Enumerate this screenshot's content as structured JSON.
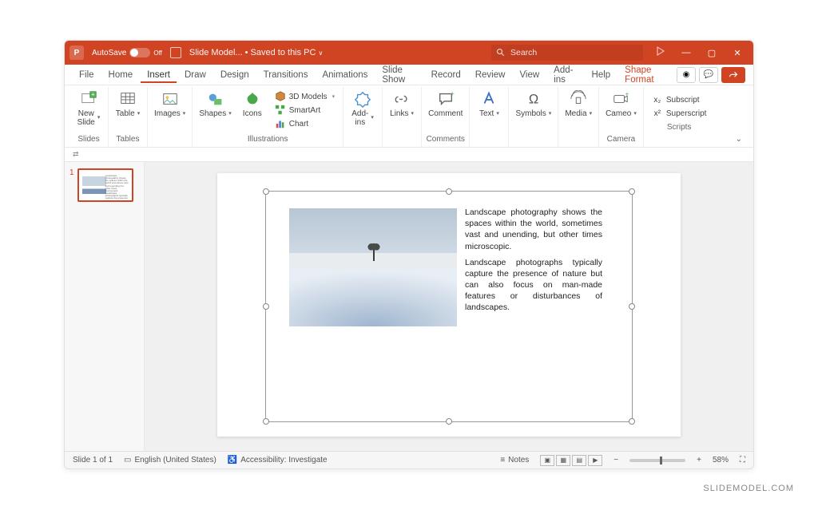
{
  "titlebar": {
    "autosave_label": "AutoSave",
    "autosave_state": "Off",
    "doc_name": "Slide Model...",
    "save_status": "Saved to this PC",
    "search_placeholder": "Search"
  },
  "tabs": {
    "file": "File",
    "home": "Home",
    "insert": "Insert",
    "draw": "Draw",
    "design": "Design",
    "transitions": "Transitions",
    "animations": "Animations",
    "slideshow": "Slide Show",
    "record": "Record",
    "review": "Review",
    "view": "View",
    "addins": "Add-ins",
    "help": "Help",
    "shape_format": "Shape Format"
  },
  "ribbon": {
    "slides": {
      "group": "Slides",
      "new_slide": "New\nSlide"
    },
    "tables": {
      "group": "Tables",
      "table": "Table"
    },
    "images": {
      "group": "",
      "images": "Images"
    },
    "illus": {
      "group": "Illustrations",
      "shapes": "Shapes",
      "icons": "Icons",
      "models": "3D Models",
      "smartart": "SmartArt",
      "chart": "Chart"
    },
    "addins_grp": {
      "group": "",
      "addins": "Add-\nins"
    },
    "links": {
      "group": "",
      "links": "Links"
    },
    "comments": {
      "group": "Comments",
      "comment": "Comment"
    },
    "text": {
      "group": "",
      "text": "Text"
    },
    "symbols": {
      "group": "",
      "symbols": "Symbols"
    },
    "media": {
      "group": "",
      "media": "Media"
    },
    "camera": {
      "group": "Camera",
      "cameo": "Cameo"
    },
    "scripts": {
      "group": "Scripts",
      "subscript": "Subscript",
      "superscript": "Superscript"
    }
  },
  "thumbnails": {
    "n1": "1"
  },
  "slide": {
    "para1": "Landscape photography shows the spaces within the world, sometimes vast and unending, but other times microscopic.",
    "para2": "Landscape photographs typically capture the presence of nature but can also focus on man-made features or disturbances of landscapes."
  },
  "statusbar": {
    "slide_pos": "Slide 1 of 1",
    "language": "English (United States)",
    "accessibility": "Accessibility: Investigate",
    "notes": "Notes",
    "zoom": "58%"
  },
  "watermark": "SLIDEMODEL.COM"
}
